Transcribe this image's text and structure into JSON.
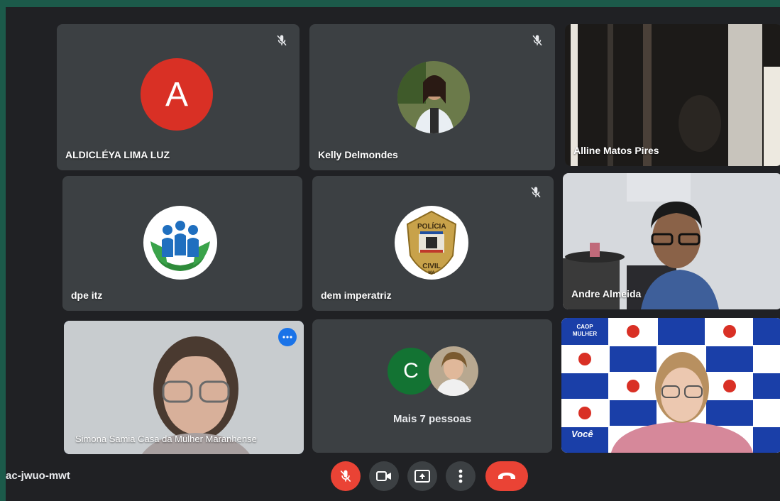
{
  "tiles": {
    "aldicleya": {
      "name": "ALDICLÉYA LIMA LUZ",
      "avatar_letter": "A",
      "avatar_color": "#d93025",
      "muted": true
    },
    "kelly": {
      "name": "Kelly Delmondes",
      "muted": true
    },
    "alline": {
      "name": "Alline Matos Pires"
    },
    "dpe": {
      "name": "dpe itz"
    },
    "dem": {
      "name": "dem imperatriz",
      "muted": true,
      "logo_text_top": "POLÍCIA",
      "logo_text_bottom": "CIVIL",
      "logo_text_state": "MA"
    },
    "andre": {
      "name": "Andre Almeida"
    },
    "simona": {
      "name": "Simona Samia Casa da Mulher Maranhense",
      "active": true
    },
    "more": {
      "label": "Mais 7 pessoas",
      "avatar_letter": "C",
      "avatar_color": "#137333"
    },
    "caop": {
      "banner_text": "CAOP MULHER",
      "banner_bottom": "Você"
    }
  },
  "controls": {
    "meeting_code": "ac-jwuo-mwt",
    "mic_icon": "mic-off-icon",
    "camera_icon": "camera-icon",
    "present_icon": "present-icon",
    "more_icon": "more-vert-icon",
    "hangup_icon": "hangup-icon"
  },
  "colors": {
    "background": "#202124",
    "tile": "#3c4043",
    "danger": "#ea4335",
    "active_outline": "#8ab4f8"
  }
}
